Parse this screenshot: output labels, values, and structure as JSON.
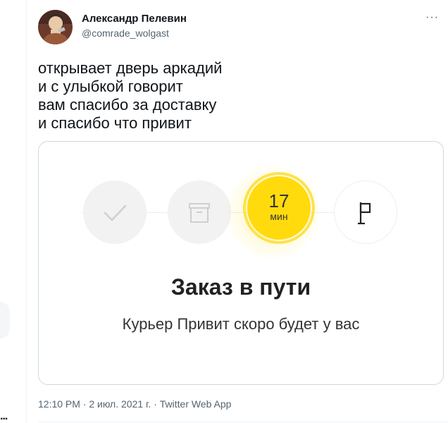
{
  "tweet": {
    "author": {
      "name": "Александр Пелевин",
      "handle": "@comrade_wolgast"
    },
    "more_icon": "ellipsis-icon",
    "text_lines": [
      "открывает дверь аркадий",
      "и с улыбкой говорит",
      "вам спасибо за доставку",
      "и спасибо что привит"
    ],
    "timestamp": "12:10 PM · 2 июл. 2021 г. · Twitter Web App"
  },
  "media": {
    "steps": [
      {
        "icon": "check-icon",
        "state": "done"
      },
      {
        "icon": "package-icon",
        "state": "done"
      },
      {
        "icon": "timer",
        "state": "current"
      },
      {
        "icon": "flag-icon",
        "state": "pending"
      }
    ],
    "timer": {
      "value": "17",
      "unit": "мин"
    },
    "title": "Заказ в пути",
    "subtitle": "Курьер Привит скоро будет у вас",
    "colors": {
      "accent": "#ffdb0d",
      "inactive": "#f2f2f2"
    }
  },
  "sidebar": {
    "dots": "..."
  }
}
